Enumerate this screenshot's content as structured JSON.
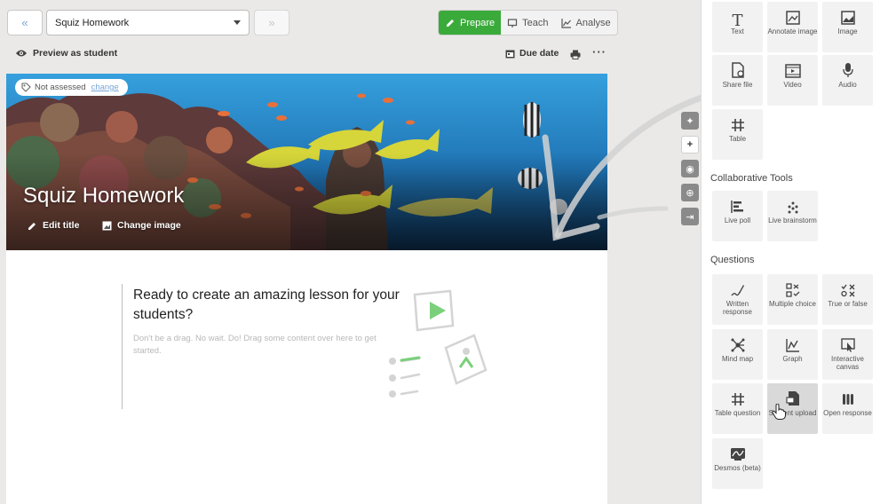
{
  "header": {
    "prev_icon": "«",
    "next_icon": "»",
    "lesson_select": "Squiz Homework",
    "modes": [
      {
        "label": "Prepare",
        "icon": "pencil-icon",
        "active": true
      },
      {
        "label": "Teach",
        "icon": "presentation-icon",
        "active": false
      },
      {
        "label": "Analyse",
        "icon": "line-chart-icon",
        "active": false
      }
    ],
    "accent": "#3aaa3a"
  },
  "subbar": {
    "preview": "Preview as student",
    "due": "Due date",
    "more": "···"
  },
  "hero": {
    "assessed": "Not assessed",
    "change": "change",
    "title": "Squiz Homework",
    "edit_title": "Edit title",
    "change_image": "Change image"
  },
  "empty": {
    "title": "Ready to create an amazing lesson for your students?",
    "desc": "Don't be a drag. No wait. Do! Drag some content over here to get started."
  },
  "side_buttons": [
    "✦",
    "+",
    "◉",
    "⊕",
    "⇥"
  ],
  "panel": {
    "content_tiles": [
      "Text",
      "Annotate image",
      "Image",
      "Share file",
      "Video",
      "Audio",
      "Table"
    ],
    "collab_heading": "Collaborative Tools",
    "collab_tiles": [
      "Live poll",
      "Live brainstorm"
    ],
    "questions_heading": "Questions",
    "question_tiles": [
      "Written response",
      "Multiple choice",
      "True or false",
      "Mind map",
      "Graph",
      "Interactive canvas",
      "Table question",
      "Student upload",
      "Open response",
      "Desmos (beta)"
    ]
  }
}
